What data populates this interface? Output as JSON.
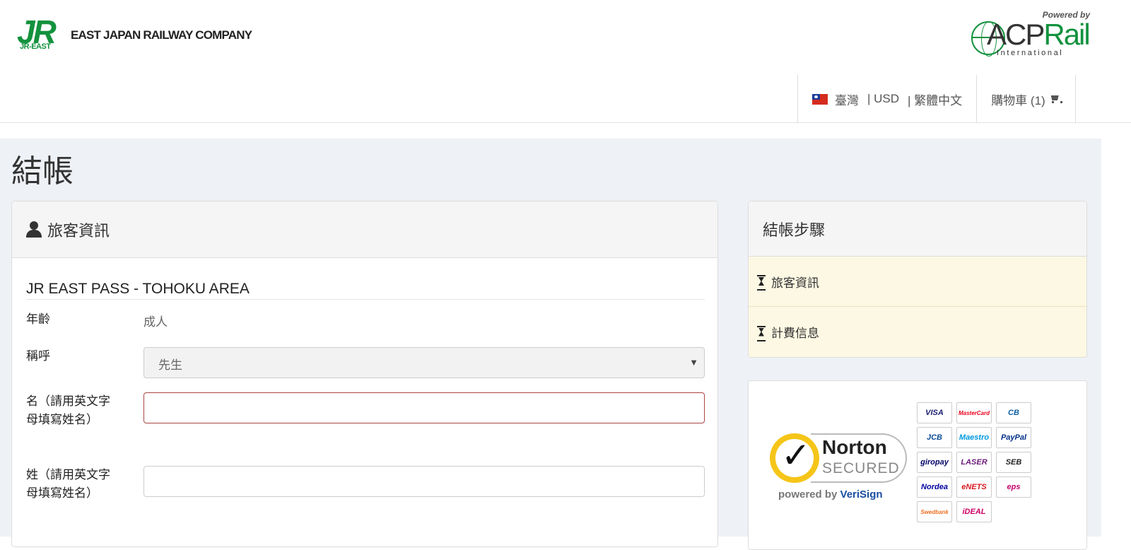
{
  "header": {
    "jr_logo_mark": "JR",
    "jr_logo_sub": "JR-EAST",
    "jr_company": "EAST JAPAN RAILWAY COMPANY",
    "acp_powered_by": "Powered by",
    "acp_name_a": "ACP",
    "acp_name_b": "Rail",
    "acp_international": "International",
    "nav": {
      "country": "臺灣",
      "currency": "| USD",
      "language": "| 繁體中文",
      "cart": "購物車 (1)"
    }
  },
  "page": {
    "title": "結帳"
  },
  "traveler_panel": {
    "heading": "旅客資訊",
    "pass_title": "JR EAST PASS - TOHOKU AREA",
    "fields": {
      "age_label": "年齡",
      "age_value": "成人",
      "salutation_label": "稱呼",
      "salutation_value": "先生",
      "first_name_label": "名（請用英文字母填寫姓名）",
      "first_name_value": "",
      "last_name_label": "姓（請用英文字母填寫姓名）",
      "last_name_value": ""
    }
  },
  "steps_panel": {
    "heading": "結帳步驟",
    "steps": [
      {
        "label": "旅客資訊"
      },
      {
        "label": "計費信息"
      }
    ]
  },
  "security_panel": {
    "norton_brand": "Norton",
    "norton_secured": "SECURED",
    "norton_powered": "powered by",
    "norton_verisign": "VeriSign",
    "payment_methods": [
      {
        "name": "VISA",
        "color": "#1a1f71"
      },
      {
        "name": "MasterCard",
        "color": "#eb001b"
      },
      {
        "name": "CB",
        "color": "#0a5fa5"
      },
      {
        "name": "JCB",
        "color": "#0e4c96"
      },
      {
        "name": "Maestro",
        "color": "#0099df"
      },
      {
        "name": "PayPal",
        "color": "#003087"
      },
      {
        "name": "giropay",
        "color": "#000268"
      },
      {
        "name": "LASER",
        "color": "#6b1a7a"
      },
      {
        "name": "SEB",
        "color": "#222222"
      },
      {
        "name": "Nordea",
        "color": "#0000a0"
      },
      {
        "name": "eNETS",
        "color": "#d71920"
      },
      {
        "name": "eps",
        "color": "#c8036f"
      },
      {
        "name": "Swedbank",
        "color": "#ee7023"
      },
      {
        "name": "iDEAL",
        "color": "#cc0066"
      }
    ]
  },
  "colors": {
    "brand_green": "#13923e",
    "page_bg": "#eef1f5",
    "step_bg": "#fcf8e3",
    "error_border": "#a94442"
  }
}
